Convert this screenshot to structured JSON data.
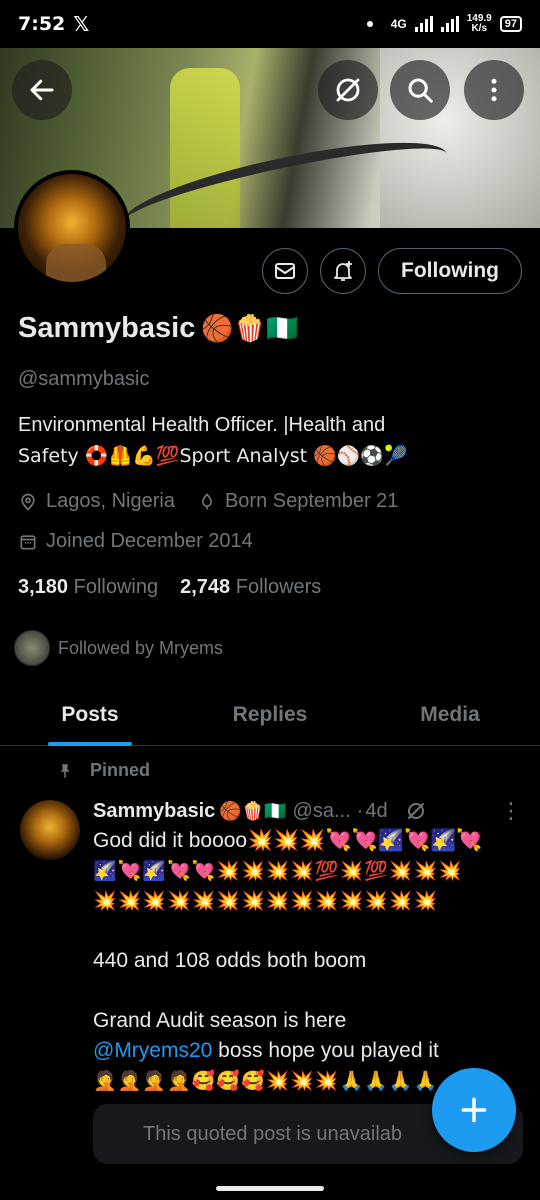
{
  "status_bar": {
    "time": "7:52",
    "x_logo": "𝕏",
    "network": "4G",
    "net_speed_value": "149.9",
    "net_speed_unit": "K/s",
    "battery": "97"
  },
  "header": {
    "back_icon": "arrow-left-icon",
    "grok_icon": "grok-icon",
    "search_icon": "search-icon",
    "more_icon": "more-vertical-icon"
  },
  "profile": {
    "name": "Sammybasic",
    "name_emojis": "🏀🍿🇳🇬",
    "handle": "@sammybasic",
    "bio_line1": "Environmental Health Officer. |Health and",
    "bio_line2": "Safety 🛟🦺💪💯Sport Analyst 🏀⚾⚽🎾",
    "location": "Lagos, Nigeria",
    "birthday": "Born September 21",
    "joined": "Joined December 2014",
    "following_count": "3,180",
    "following_label": "Following",
    "followers_count": "2,748",
    "followers_label": "Followers",
    "followed_by": "Followed by Mryems"
  },
  "actions": {
    "message_icon": "envelope-icon",
    "notify_icon": "bell-plus-icon",
    "follow_label": "Following"
  },
  "tabs": [
    {
      "label": "Posts",
      "active": true
    },
    {
      "label": "Replies",
      "active": false
    },
    {
      "label": "Media",
      "active": false
    }
  ],
  "post": {
    "pinned_label": "Pinned",
    "author_name": "Sammybasic",
    "author_emojis": "🏀🍿🇳🇬",
    "author_handle": "@sa...",
    "separator": "·",
    "time": "4d",
    "text_first": "God did it boooo💥💥💥💘💘🌠💘🌠💘",
    "text_emoji_line1": "🌠💘🌠💘💘💥💥💥💥💯💥💯💥💥💥",
    "text_emoji_line2": "💥💥💥💥💥💥💥💥💥💥💥💥💥💥",
    "text_line2": "440 and 108 odds both boom",
    "text_line3": "Grand Audit season is here",
    "mention": "@Mryems20",
    "text_line4_rest": " boss hope you played it",
    "text_emoji_line3": "🤦🤦🤦🤦🥰🥰🥰💥💥💥🙏🙏🙏🙏",
    "quoted_unavailable": "This quoted post is unavailab"
  },
  "colors": {
    "accent": "#1d9bf0",
    "background": "#000000",
    "secondary_text": "#71767b"
  }
}
